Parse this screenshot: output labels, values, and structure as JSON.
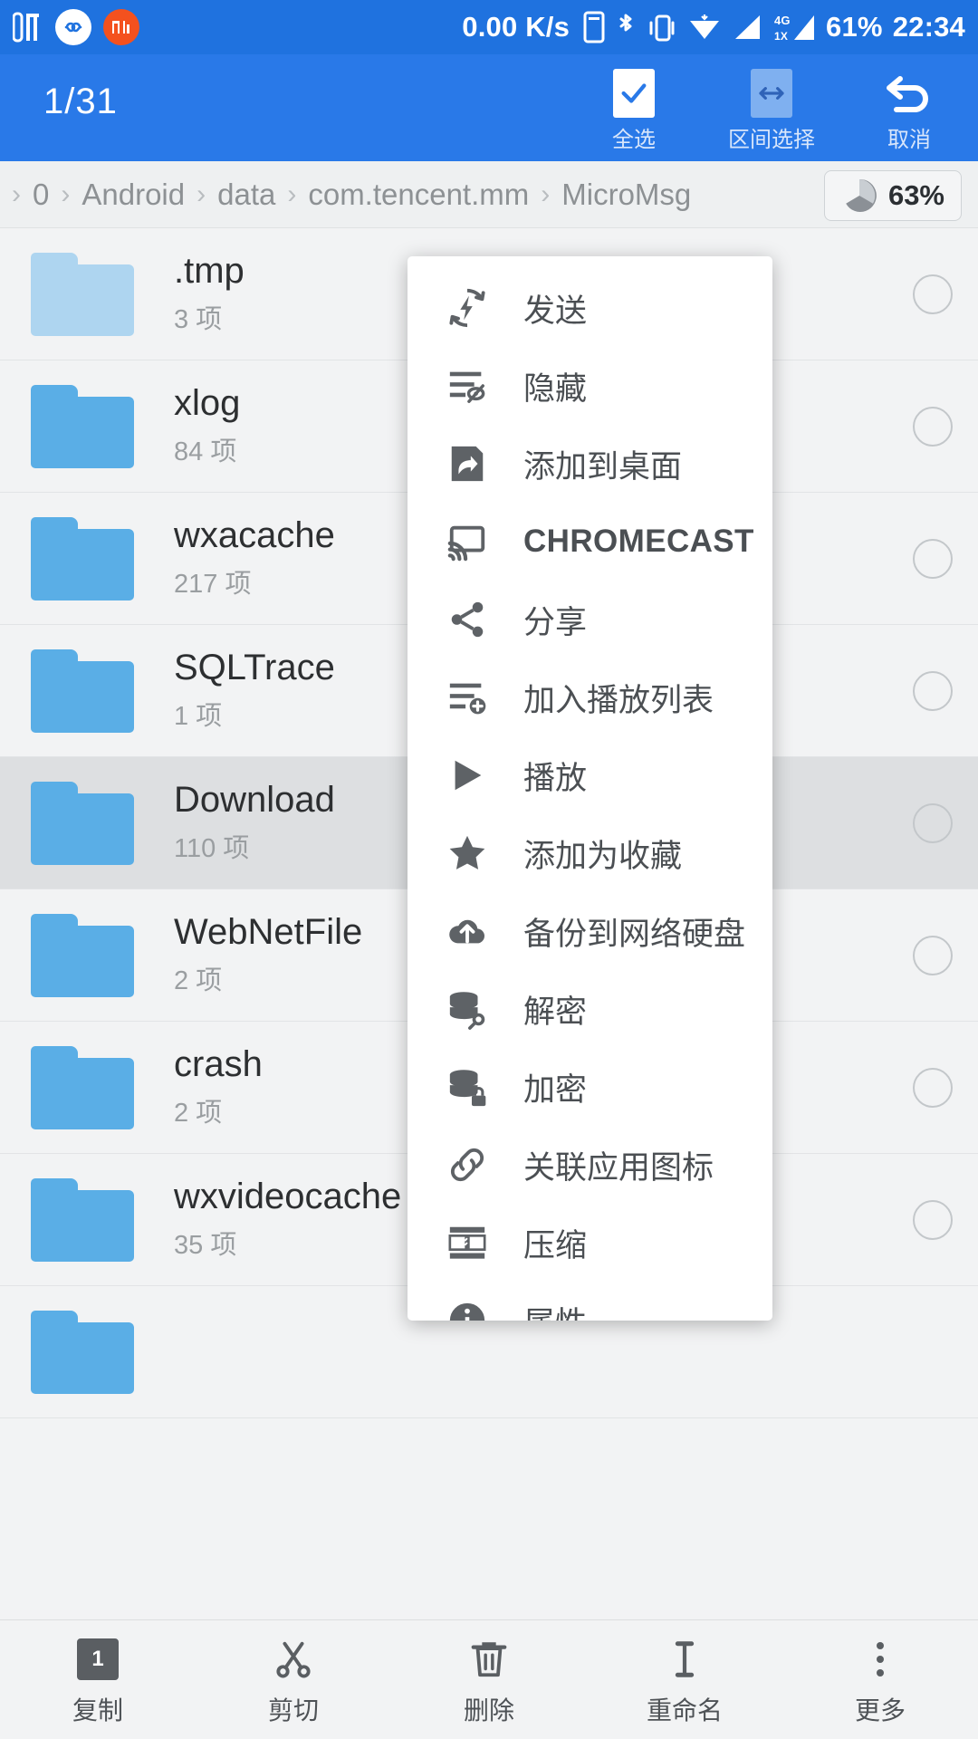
{
  "status_bar": {
    "net_speed": "0.00 K/s",
    "battery": "61%",
    "clock": "22:34",
    "signal_4g": "4G",
    "signal_1x": "1X",
    "icons": [
      "music-app-icon",
      "infinity-app-icon",
      "mi-app-icon",
      "sim-card-icon",
      "bluetooth-icon",
      "vibrate-icon",
      "wifi-icon",
      "signal-bars-icon"
    ]
  },
  "selection_toolbar": {
    "count": "1/31",
    "actions": [
      {
        "label": "全选",
        "icon": "checkbox-checked-icon"
      },
      {
        "label": "区间选择",
        "icon": "range-select-icon"
      },
      {
        "label": "取消",
        "icon": "cancel-undo-icon"
      }
    ]
  },
  "breadcrumb": {
    "items": [
      "",
      "0",
      "Android",
      "data",
      "com.tencent.mm",
      "MicroMsg"
    ],
    "separator": "›",
    "storage": {
      "percent": "63%",
      "icon": "pie-chart-icon"
    }
  },
  "file_list": {
    "count_suffix": "项",
    "rows": [
      {
        "name": ".tmp",
        "count": "3 项",
        "icon": "folder-hidden-icon",
        "dim": true,
        "selected": false
      },
      {
        "name": "xlog",
        "count": "84 项",
        "icon": "folder-icon",
        "dim": false,
        "selected": false
      },
      {
        "name": "wxacache",
        "count": "217 项",
        "icon": "folder-icon",
        "dim": false,
        "selected": false
      },
      {
        "name": "SQLTrace",
        "count": "1 项",
        "icon": "folder-icon",
        "dim": false,
        "selected": false
      },
      {
        "name": "Download",
        "count": "110 项",
        "icon": "folder-icon",
        "dim": false,
        "selected": true
      },
      {
        "name": "WebNetFile",
        "count": "2 项",
        "icon": "folder-icon",
        "dim": false,
        "selected": false
      },
      {
        "name": "crash",
        "count": "2 项",
        "icon": "folder-icon",
        "dim": false,
        "selected": false
      },
      {
        "name": "wxvideocache",
        "count": "35 项",
        "icon": "folder-icon",
        "dim": false,
        "selected": false
      }
    ]
  },
  "context_menu": {
    "items": [
      {
        "label": "发送",
        "icon": "send-flash-icon"
      },
      {
        "label": "隐藏",
        "icon": "hide-eye-off-icon"
      },
      {
        "label": "添加到桌面",
        "icon": "add-to-desktop-icon"
      },
      {
        "label": "CHROMECAST",
        "icon": "chromecast-icon",
        "latin": true
      },
      {
        "label": "分享",
        "icon": "share-icon"
      },
      {
        "label": "加入播放列表",
        "icon": "playlist-add-icon"
      },
      {
        "label": "播放",
        "icon": "play-icon"
      },
      {
        "label": "添加为收藏",
        "icon": "star-icon"
      },
      {
        "label": "备份到网络硬盘",
        "icon": "cloud-upload-icon"
      },
      {
        "label": "解密",
        "icon": "database-decrypt-icon"
      },
      {
        "label": "加密",
        "icon": "database-encrypt-icon"
      },
      {
        "label": "关联应用图标",
        "icon": "link-icon"
      },
      {
        "label": "压缩",
        "icon": "compress-zip-icon"
      },
      {
        "label": "属性",
        "icon": "info-icon"
      }
    ]
  },
  "bottom_bar": {
    "items": [
      {
        "label": "复制",
        "icon": "copy-icon",
        "badge": "1"
      },
      {
        "label": "剪切",
        "icon": "scissors-icon"
      },
      {
        "label": "删除",
        "icon": "trash-icon"
      },
      {
        "label": "重命名",
        "icon": "rename-cursor-icon"
      },
      {
        "label": "更多",
        "icon": "more-vertical-icon"
      }
    ]
  },
  "colors": {
    "statusbar_blue": "#1f72df",
    "toolbar_blue": "#2979e8",
    "folder_blue": "#5aaee6",
    "folder_blue_dim": "#aed5f0",
    "list_bg": "#f2f3f4",
    "selected_row": "#dddfe1"
  }
}
